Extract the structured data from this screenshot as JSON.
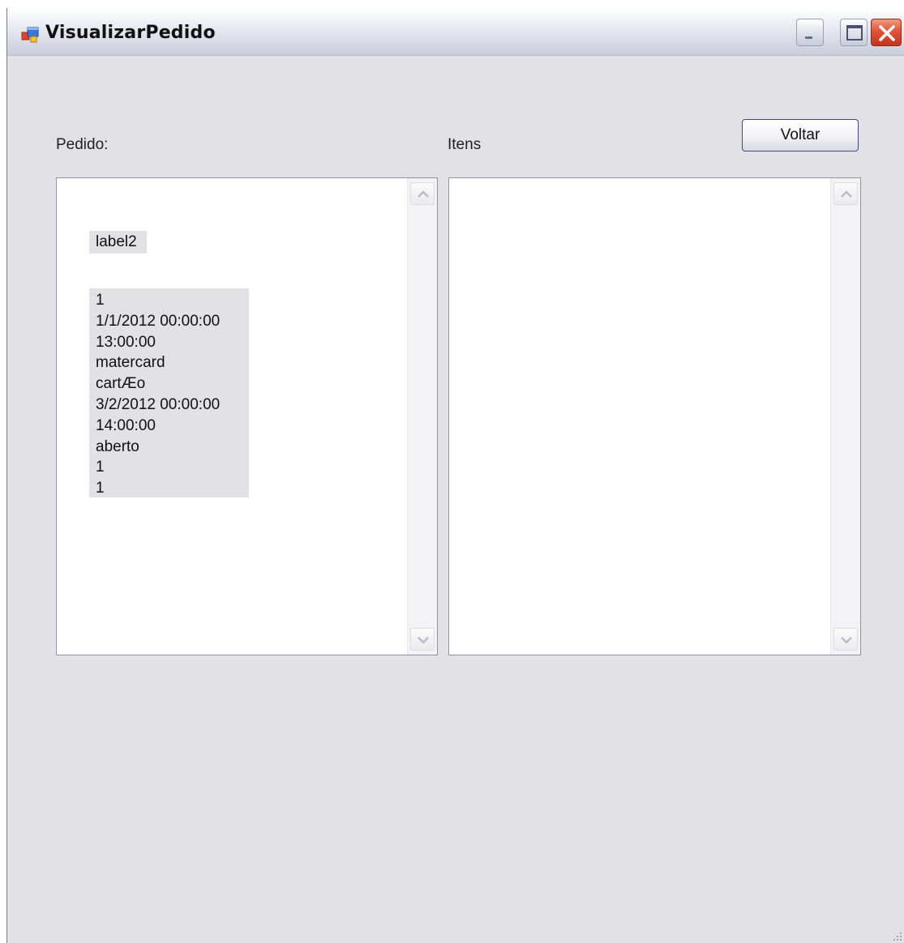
{
  "window": {
    "title": "VisualizarPedido"
  },
  "labels": {
    "pedido": "Pedido:",
    "itens": "Itens"
  },
  "buttons": {
    "voltar": "Voltar"
  },
  "pedido_panel": {
    "label2": "label2",
    "details": [
      "1",
      "1/1/2012 00:00:00",
      "13:00:00",
      "matercard",
      "cartÆo",
      "3/2/2012 00:00:00",
      "14:00:00",
      "aberto",
      "1",
      "1"
    ]
  },
  "colors": {
    "window_background": "#e1e1e6",
    "close_button": "#e0543a",
    "button_border": "#3b4e7a"
  }
}
